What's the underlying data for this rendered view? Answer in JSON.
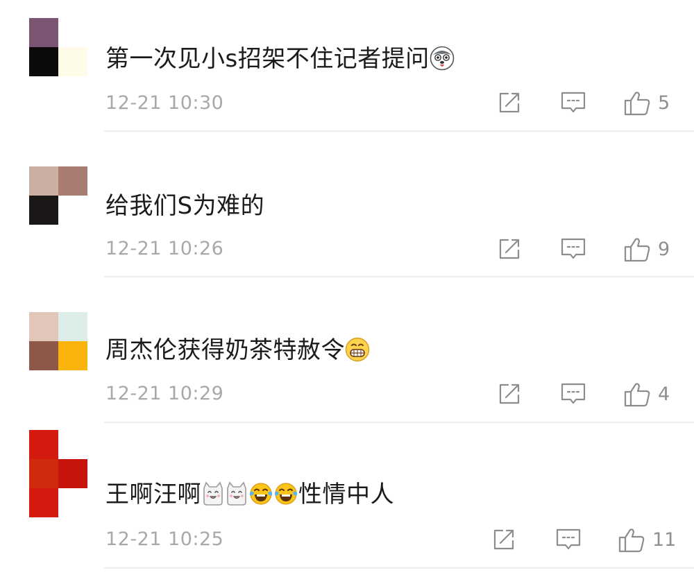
{
  "comments": [
    {
      "text": "第一次见小s招架不住记者提问",
      "emojis": [
        "husky-emoji"
      ],
      "time": "12-21 10:30",
      "likes": "5",
      "avatar": [
        "#7c5572",
        "#ffffff",
        "#0a0a0a",
        "#fefce8"
      ]
    },
    {
      "text": "给我们S为难的",
      "emojis": [],
      "time": "12-21 10:26",
      "likes": "9",
      "avatar": [
        "#c9b0a2",
        "#a87c70",
        "#1c1717",
        "#ffffff"
      ]
    },
    {
      "text": "周杰伦获得奶茶特赦令",
      "emojis": [
        "grin-emoji"
      ],
      "time": "12-21 10:29",
      "likes": "4",
      "avatar": [
        "#e2c6b9",
        "#dcece6",
        "#8d5848",
        "#fbb40d"
      ]
    },
    {
      "text_before": "王啊汪啊",
      "text_after": "性情中人",
      "emojis": [
        "cat-emoji",
        "cat-emoji",
        "tears-of-joy-emoji",
        "tears-of-joy-emoji"
      ],
      "time": "12-21 10:25",
      "likes": "11",
      "avatar": [
        "#d41a0f",
        "#ffffff",
        "#d02a0c",
        "#c7140e"
      ]
    }
  ]
}
